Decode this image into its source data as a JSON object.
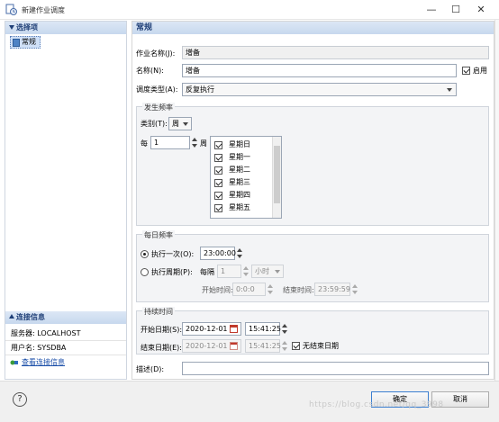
{
  "window": {
    "title": "新建作业调度",
    "min_glyph": "—",
    "max_glyph": "☐",
    "close_glyph": "✕"
  },
  "sidebar": {
    "options_header": "选择项",
    "items": [
      {
        "label": "常规"
      }
    ],
    "connection_header": "连接信息",
    "server_label": "服务器: LOCALHOST",
    "user_label": "用户名: SYSDBA",
    "view_link": "查看连接信息"
  },
  "main": {
    "header": "常规",
    "job_name_label": "作业名称(J):",
    "job_name_value": "增备",
    "name_label": "名称(N):",
    "name_value": "增备",
    "enable_label": "启用",
    "enable_checked": true,
    "schedule_type_label": "调度类型(A):",
    "schedule_type_value": "反复执行"
  },
  "frequency": {
    "group_title": "发生频率",
    "category_label": "类别(T):",
    "category_value": "周",
    "every_label": "每",
    "every_value": "1",
    "unit_label": "周",
    "weekdays": [
      {
        "label": "星期日",
        "checked": true
      },
      {
        "label": "星期一",
        "checked": true
      },
      {
        "label": "星期二",
        "checked": true
      },
      {
        "label": "星期三",
        "checked": true
      },
      {
        "label": "星期四",
        "checked": true
      },
      {
        "label": "星期五",
        "checked": true
      }
    ]
  },
  "daily": {
    "group_title": "每日频率",
    "once_label": "执行一次(O):",
    "once_selected": true,
    "once_time": "23:00:00",
    "period_label": "执行周期(P):",
    "period_selected": false,
    "every_label": "每隔",
    "every_value": "1",
    "unit_value": "小时",
    "start_label": "开始时间:",
    "start_value": "0:0:0",
    "end_label": "结束时间:",
    "end_value": "23:59:59"
  },
  "duration": {
    "group_title": "持续时间",
    "start_date_label": "开始日期(S):",
    "start_date": "2020-12-01",
    "start_time": "15:41:25",
    "end_date_label": "结束日期(E):",
    "end_date": "2020-12-01",
    "end_time": "15:41:25",
    "no_end_label": "无结束日期",
    "no_end_checked": true
  },
  "description": {
    "label": "描述(D):",
    "value": ""
  },
  "footer": {
    "help": "?",
    "ok_label": "确定",
    "cancel_label": "取消"
  },
  "watermark": "https://blog.csdn.net/qq_3998"
}
